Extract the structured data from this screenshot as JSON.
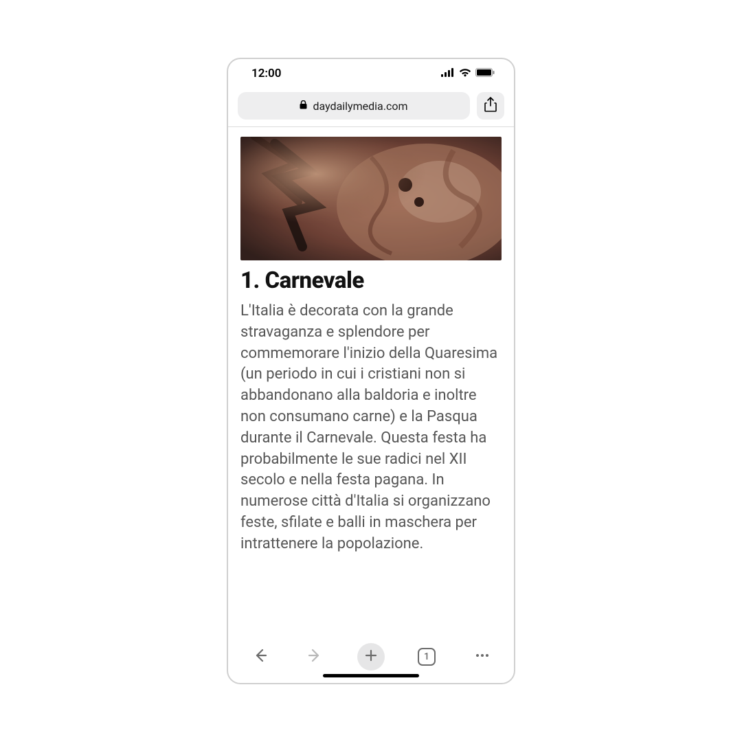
{
  "status": {
    "time": "12:00"
  },
  "address": {
    "domain": "daydailymedia.com"
  },
  "article": {
    "title": "1. Carnevale",
    "body": "L'Italia è decorata con la grande stravaganza e splendore per commemorare l'inizio della Quaresima (un periodo in cui i cristiani non si abbandonano alla baldoria e inoltre non consumano carne) e la Pasqua durante il Carnevale. Questa festa ha probabilmente le sue radici nel XII secolo e nella festa pagana. In numerose città d'Italia si organizzano feste, sfilate e balli in maschera per intrattenere la popolazione."
  },
  "bottom": {
    "tabs_count": "1"
  }
}
